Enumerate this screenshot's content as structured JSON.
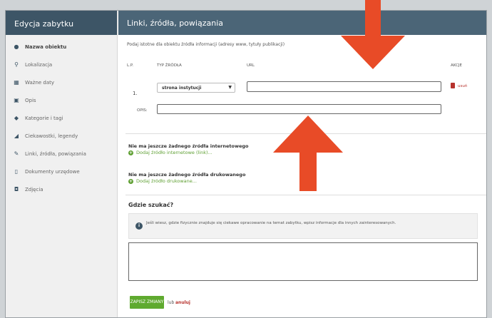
{
  "sidebar": {
    "title": "Edycja zabytku",
    "items": [
      {
        "label": "Nazwa obiektu",
        "icon": "bullet-icon"
      },
      {
        "label": "Lokalizacja",
        "icon": "map-pin-icon"
      },
      {
        "label": "Ważne daty",
        "icon": "calendar-icon"
      },
      {
        "label": "Opis",
        "icon": "text-icon"
      },
      {
        "label": "Kategorie i tagi",
        "icon": "tag-icon"
      },
      {
        "label": "Ciekawostki, legendy",
        "icon": "megaphone-icon"
      },
      {
        "label": "Linki, źródła, powiązania",
        "icon": "link-icon"
      },
      {
        "label": "Dokumenty urzędowe",
        "icon": "document-icon"
      },
      {
        "label": "Zdjęcia",
        "icon": "camera-icon"
      }
    ]
  },
  "main": {
    "title": "Linki, źródła, powiązania",
    "intro": "Podaj istotne dla obiektu źródła informacji (adresy www, tytuły publikacji)",
    "columns": {
      "lp": "L.P.",
      "type": "TYP ŹRÓDŁA",
      "url": "URL",
      "actions": "AKCJE"
    },
    "row": {
      "number": "1.",
      "source_type": "strona instytucji",
      "url_value": "",
      "delete_label": "usuń",
      "opis_label": "OPIS:",
      "opis_value": ""
    },
    "internet": {
      "empty": "Nie ma jeszcze żadnego źródła internetowego",
      "add": "Dodaj źródło internetowe (link)..."
    },
    "print": {
      "empty": "Nie ma jeszcze żadnego źródła drukowanego",
      "add": "Dodaj źródło drukowane..."
    },
    "where": {
      "title": "Gdzie szukać?",
      "info": "Jeśli wiesz, gdzie fizycznie znajduje się ciekawe opracowanie na temat zabytku, wpisz informacje dla innych zainteresowanych.",
      "textarea_value": ""
    },
    "save_label": "ZAPISZ ZMIANY",
    "or_label": "lub",
    "cancel_label": "anuluj"
  },
  "colors": {
    "sidebar_header": "#3d5566",
    "main_header": "#4b6577",
    "accent_green": "#5faa2f",
    "danger_red": "#b7322d",
    "overlay_arrow": "#e84b27"
  }
}
